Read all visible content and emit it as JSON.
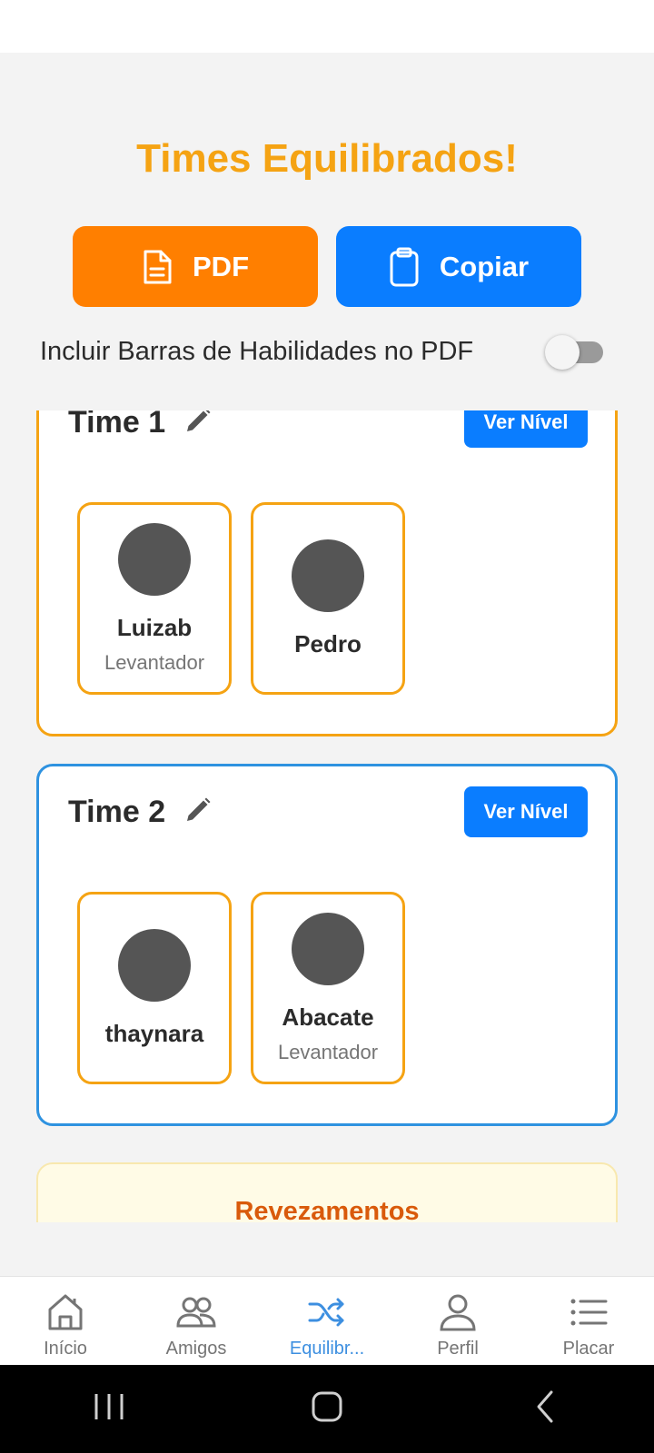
{
  "header": {
    "title": "Times Equilibrados!"
  },
  "actions": {
    "pdf_label": "PDF",
    "copy_label": "Copiar",
    "pdf_icon": "document-icon",
    "copy_icon": "clipboard-icon"
  },
  "toggle": {
    "label": "Incluir Barras de Habilidades no PDF",
    "checked": false
  },
  "teams": [
    {
      "name": "Time 1",
      "button_label": "Ver Nível",
      "border_color": "#f5a313",
      "players": [
        {
          "name": "Luizab",
          "role": "Levantador"
        },
        {
          "name": "Pedro",
          "role": ""
        }
      ]
    },
    {
      "name": "Time 2",
      "button_label": "Ver Nível",
      "border_color": "#2e92e0",
      "players": [
        {
          "name": "thaynara",
          "role": ""
        },
        {
          "name": "Abacate",
          "role": "Levantador"
        }
      ]
    }
  ],
  "revezamentos": {
    "title": "Revezamentos"
  },
  "bottom_nav": {
    "items": [
      {
        "label": "Início",
        "icon": "home-icon"
      },
      {
        "label": "Amigos",
        "icon": "friends-icon"
      },
      {
        "label": "Equilibr...",
        "icon": "shuffle-icon",
        "active": true
      },
      {
        "label": "Perfil",
        "icon": "profile-icon"
      },
      {
        "label": "Placar",
        "icon": "list-icon"
      }
    ]
  },
  "colors": {
    "accent_orange": "#ff7f00",
    "title_yellow": "#f5a313",
    "primary_blue": "#0a7dff",
    "active_nav": "#3d8fe0"
  }
}
